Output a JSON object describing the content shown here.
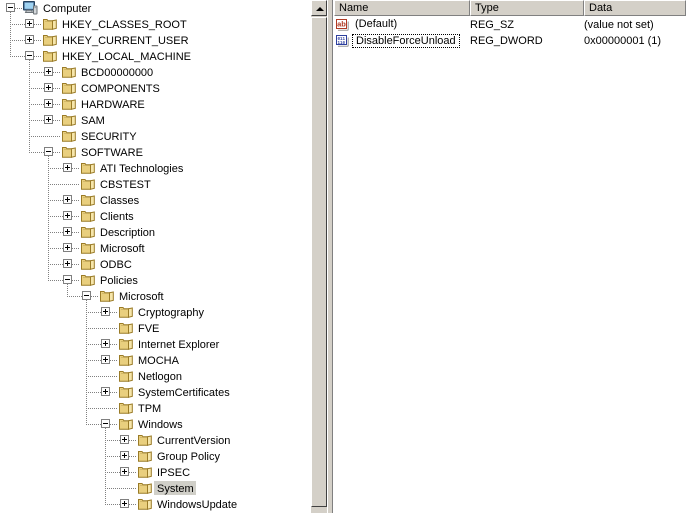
{
  "window": {
    "app": "registry-editor",
    "selection_highlight": "#d0cfc8",
    "chrome_face": "#d4d0c8",
    "pane_background": "#ffffff"
  },
  "tree": {
    "root_label": "Computer",
    "selected_key": "System",
    "nodes": [
      {
        "label": "Computer",
        "depth": 0,
        "expander": "minus",
        "icon": "computer-icon"
      },
      {
        "label": "HKEY_CLASSES_ROOT",
        "depth": 1,
        "expander": "plus",
        "icon": "folder-icon"
      },
      {
        "label": "HKEY_CURRENT_USER",
        "depth": 1,
        "expander": "plus",
        "icon": "folder-icon"
      },
      {
        "label": "HKEY_LOCAL_MACHINE",
        "depth": 1,
        "expander": "minus",
        "icon": "folder-icon"
      },
      {
        "label": "BCD00000000",
        "depth": 2,
        "expander": "plus",
        "icon": "folder-icon"
      },
      {
        "label": "COMPONENTS",
        "depth": 2,
        "expander": "plus",
        "icon": "folder-icon"
      },
      {
        "label": "HARDWARE",
        "depth": 2,
        "expander": "plus",
        "icon": "folder-icon"
      },
      {
        "label": "SAM",
        "depth": 2,
        "expander": "plus",
        "icon": "folder-icon"
      },
      {
        "label": "SECURITY",
        "depth": 2,
        "expander": "none",
        "icon": "folder-icon"
      },
      {
        "label": "SOFTWARE",
        "depth": 2,
        "expander": "minus",
        "icon": "folder-icon"
      },
      {
        "label": "ATI Technologies",
        "depth": 3,
        "expander": "plus",
        "icon": "folder-icon"
      },
      {
        "label": "CBSTEST",
        "depth": 3,
        "expander": "none",
        "icon": "folder-icon"
      },
      {
        "label": "Classes",
        "depth": 3,
        "expander": "plus",
        "icon": "folder-icon"
      },
      {
        "label": "Clients",
        "depth": 3,
        "expander": "plus",
        "icon": "folder-icon"
      },
      {
        "label": "Description",
        "depth": 3,
        "expander": "plus",
        "icon": "folder-icon"
      },
      {
        "label": "Microsoft",
        "depth": 3,
        "expander": "plus",
        "icon": "folder-icon"
      },
      {
        "label": "ODBC",
        "depth": 3,
        "expander": "plus",
        "icon": "folder-icon"
      },
      {
        "label": "Policies",
        "depth": 3,
        "expander": "minus",
        "icon": "folder-icon"
      },
      {
        "label": "Microsoft",
        "depth": 4,
        "expander": "minus",
        "icon": "folder-icon"
      },
      {
        "label": "Cryptography",
        "depth": 5,
        "expander": "plus",
        "icon": "folder-icon"
      },
      {
        "label": "FVE",
        "depth": 5,
        "expander": "none",
        "icon": "folder-icon"
      },
      {
        "label": "Internet Explorer",
        "depth": 5,
        "expander": "plus",
        "icon": "folder-icon"
      },
      {
        "label": "MOCHA",
        "depth": 5,
        "expander": "plus",
        "icon": "folder-icon"
      },
      {
        "label": "Netlogon",
        "depth": 5,
        "expander": "none",
        "icon": "folder-icon"
      },
      {
        "label": "SystemCertificates",
        "depth": 5,
        "expander": "plus",
        "icon": "folder-icon"
      },
      {
        "label": "TPM",
        "depth": 5,
        "expander": "none",
        "icon": "folder-icon"
      },
      {
        "label": "Windows",
        "depth": 5,
        "expander": "minus",
        "icon": "folder-icon"
      },
      {
        "label": "CurrentVersion",
        "depth": 6,
        "expander": "plus",
        "icon": "folder-icon"
      },
      {
        "label": "Group Policy",
        "depth": 6,
        "expander": "plus",
        "icon": "folder-icon"
      },
      {
        "label": "IPSEC",
        "depth": 6,
        "expander": "plus",
        "icon": "folder-icon"
      },
      {
        "label": "System",
        "depth": 6,
        "expander": "none",
        "icon": "folder-icon",
        "selected": true
      },
      {
        "label": "WindowsUpdate",
        "depth": 6,
        "expander": "plus",
        "icon": "folder-icon"
      }
    ]
  },
  "scrollbar": {
    "up_arrow": "scroll-up-arrow-icon",
    "position": "top"
  },
  "values": {
    "columns": [
      "Name",
      "Type",
      "Data"
    ],
    "rows": [
      {
        "name": "(Default)",
        "type": "REG_SZ",
        "data": "(value not set)",
        "icon": "string-value-icon",
        "focused": false
      },
      {
        "name": "DisableForceUnload",
        "type": "REG_DWORD",
        "data": "0x00000001 (1)",
        "icon": "binary-value-icon",
        "focused": true
      }
    ]
  }
}
